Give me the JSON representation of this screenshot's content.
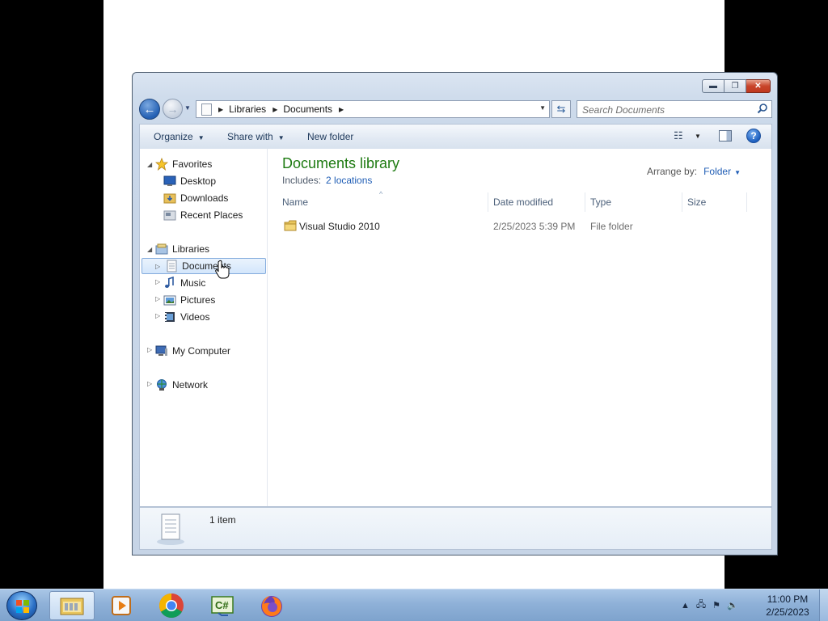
{
  "window": {
    "controls": {
      "minimize": "▬",
      "maximize": "❐",
      "close": "✕"
    }
  },
  "address": {
    "breadcrumbs": [
      "Libraries",
      "Documents"
    ],
    "search_placeholder": "Search Documents"
  },
  "toolbar": {
    "organize": "Organize",
    "share_with": "Share with",
    "new_folder": "New folder",
    "help": "?"
  },
  "navpane": {
    "favorites": "Favorites",
    "favorites_items": [
      "Desktop",
      "Downloads",
      "Recent Places"
    ],
    "libraries": "Libraries",
    "libraries_items": [
      "Documents",
      "Music",
      "Pictures",
      "Videos"
    ],
    "computer": "My Computer",
    "network": "Network"
  },
  "library": {
    "title": "Documents library",
    "includes_label": "Includes:",
    "includes_link": "2 locations",
    "arrange_label": "Arrange by:",
    "arrange_value": "Folder"
  },
  "columns": [
    "Name",
    "Date modified",
    "Type",
    "Size"
  ],
  "files": [
    {
      "name": "Visual Studio 2010",
      "date": "2/25/2023 5:39 PM",
      "type": "File folder",
      "size": ""
    }
  ],
  "details": {
    "count": "1 item"
  },
  "taskbar": {
    "time": "11:00 PM",
    "date": "2/25/2023",
    "apps": [
      "windows-explorer",
      "media-player",
      "chrome",
      "visual-csharp",
      "firefox"
    ],
    "colors": {
      "accent": "#2a6fc5",
      "library_title": "#1e7b12",
      "link": "#1f5db5"
    }
  }
}
